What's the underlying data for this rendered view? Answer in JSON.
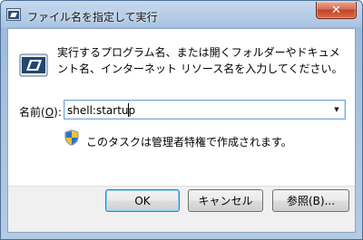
{
  "window": {
    "title": "ファイル名を指定して実行",
    "close_glyph": "✕",
    "title_icon": "run-dialog-icon"
  },
  "content": {
    "description": "実行するプログラム名、または開くフォルダーやドキュメント名、インターネット リソース名を入力してください。",
    "name_label_prefix": "名前(",
    "name_label_mnemonic": "O",
    "name_label_suffix": "):",
    "command_value": "shell:startup",
    "dropdown_glyph": "▼",
    "admin_note": "このタスクは管理者特権で作成されます。",
    "icon": "run-dialog-icon",
    "shield_icon": "uac-shield-icon"
  },
  "buttons": {
    "ok": "OK",
    "cancel": "キャンセル",
    "browse": "参照(B)..."
  }
}
